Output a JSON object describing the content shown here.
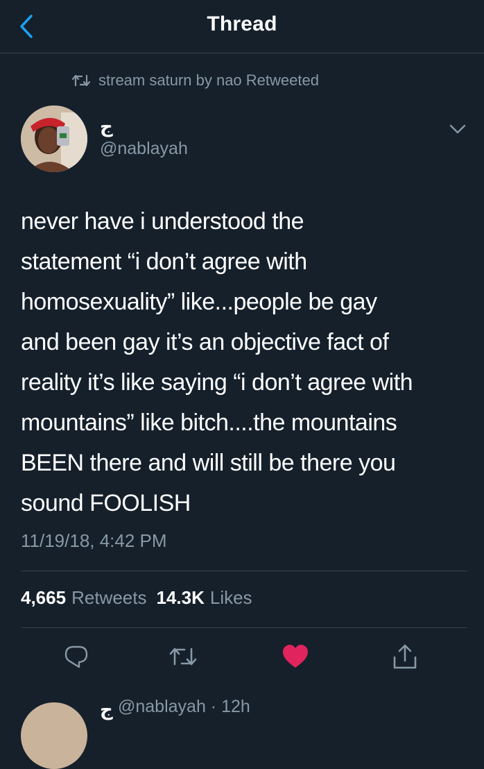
{
  "header": {
    "title": "Thread",
    "back_icon": "chevron-left-icon"
  },
  "retweet": {
    "icon": "retweet-icon",
    "text": "stream saturn by nao Retweeted"
  },
  "author": {
    "display_name": "ج",
    "handle": "@nablayah"
  },
  "tweet": {
    "text": "never have i understood the\nstatement “i don’t agree with\nhomosexuality” like...people be gay\nand been gay it’s an objective fact of\nreality it’s like saying “i don’t agree with\nmountains” like bitch....the mountains\nBEEN there and will still be there you\nsound FOOLISH",
    "timestamp": "11/19/18, 4:42 PM"
  },
  "stats": {
    "retweets_count": "4,665",
    "retweets_label": "Retweets",
    "likes_count": "14.3K",
    "likes_label": "Likes"
  },
  "actions": {
    "reply_icon": "reply-icon",
    "retweet_icon": "retweet-icon",
    "like_icon": "heart-icon",
    "share_icon": "share-icon",
    "liked": true
  },
  "next_reply": {
    "display_name": "ج",
    "handle_partial": "@nablayah · 12h"
  },
  "colors": {
    "background": "#15202b",
    "secondary_text": "#8899a6",
    "accent": "#1da1f2",
    "like": "#e0245e",
    "divider": "#38444d"
  }
}
